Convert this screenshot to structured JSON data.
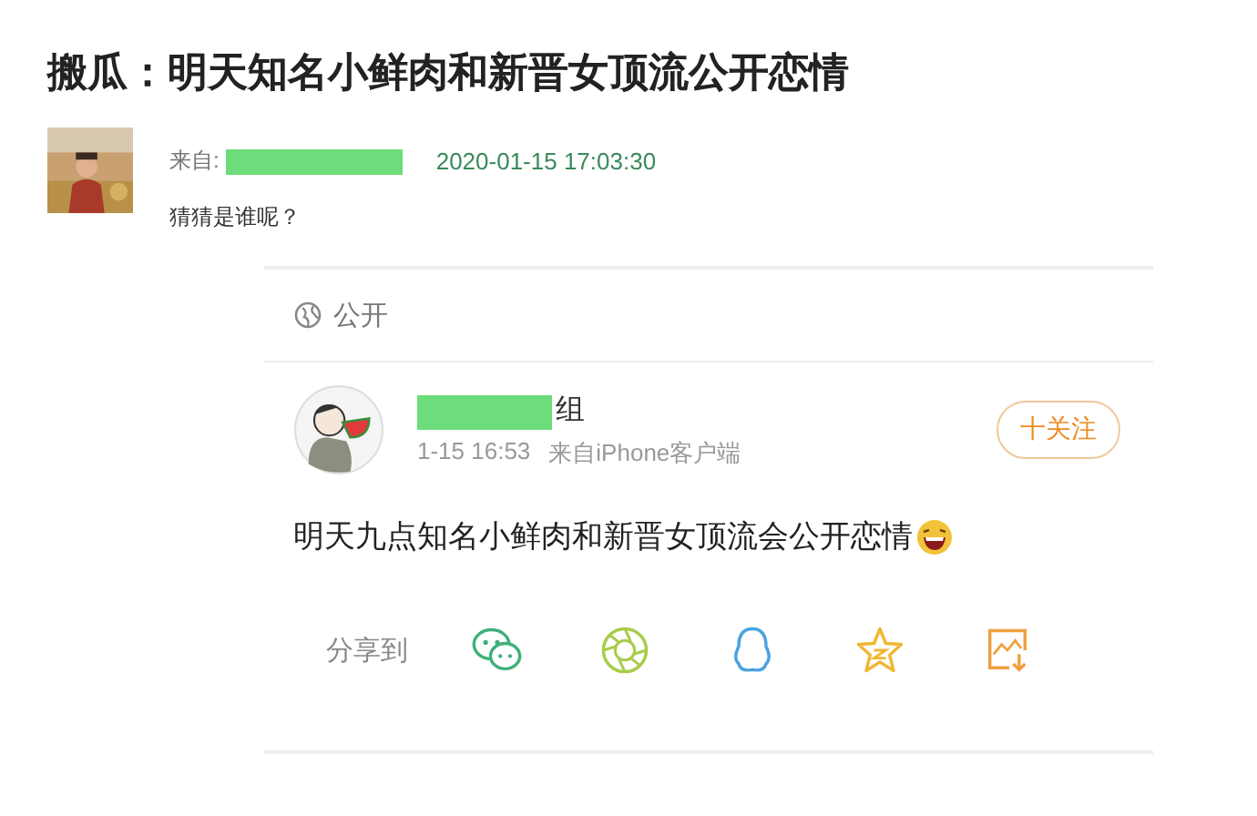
{
  "title": "搬瓜：明天知名小鲜肉和新晋女顶流公开恋情",
  "meta": {
    "from_label": "来自:",
    "date": "2020-01-15 17:03:30"
  },
  "intro": "猜猜是谁呢？",
  "card": {
    "visibility": "公开",
    "user": {
      "name": "组",
      "time": "1-15 16:53",
      "source": "来自iPhone客户端"
    },
    "follow_button": "十关注",
    "post": "明天九点知名小鲜肉和新晋女顶流会公开恋情",
    "share_label": "分享到",
    "share_targets": [
      {
        "kind": "wechat"
      },
      {
        "kind": "moments"
      },
      {
        "kind": "qq"
      },
      {
        "kind": "qzone"
      },
      {
        "kind": "save"
      }
    ]
  }
}
